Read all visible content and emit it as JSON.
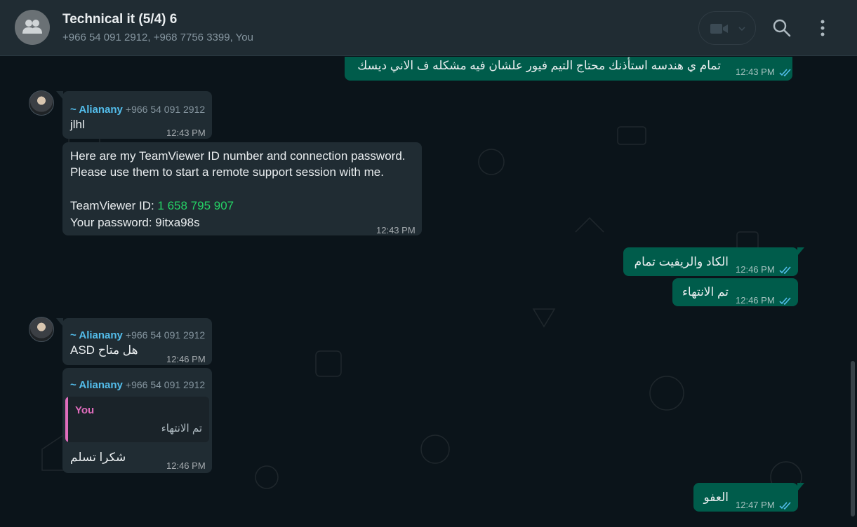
{
  "header": {
    "title": "Technical it (5/4) 6",
    "participants": "+966 54 091 2912, +968 7756 3399, You",
    "avatar_icon": "group-icon",
    "video_icon": "video-camera-icon",
    "search_icon": "search-icon",
    "menu_icon": "more-vertical-icon"
  },
  "messages": [
    {
      "id": "m1",
      "direction": "out",
      "text": "تمام ي هندسه استأذنك محتاج التيم فيور علشان فيه مشكله ف الاني ديسك",
      "time": "12:43 PM",
      "status": "read"
    },
    {
      "id": "m2",
      "direction": "in",
      "sender": "~ Alianany",
      "phone": "+966 54 091 2912",
      "text": "jlhl",
      "time": "12:43 PM"
    },
    {
      "id": "m3",
      "direction": "in",
      "line1": "Here are my TeamViewer ID number and connection password.",
      "line2": "Please use them to start a remote support session with me.",
      "id_label": "TeamViewer ID: ",
      "id_value": "1 658 795 907",
      "password_line": "Your password: 9itxa98s",
      "time": "12:43 PM"
    },
    {
      "id": "m4",
      "direction": "out",
      "text": "الكاد والريفيت تمام",
      "time": "12:46 PM",
      "status": "read"
    },
    {
      "id": "m5",
      "direction": "out",
      "text": "تم الانتهاء",
      "time": "12:46 PM",
      "status": "read"
    },
    {
      "id": "m6",
      "direction": "in",
      "sender": "~ Alianany",
      "phone": "+966 54 091 2912",
      "text": "هل متاح ASD",
      "time": "12:46 PM"
    },
    {
      "id": "m7",
      "direction": "in",
      "sender": "~ Alianany",
      "phone": "+966 54 091 2912",
      "quote_author": "You",
      "quote_text": "تم الانتهاء",
      "text": "شكرا تسلم",
      "time": "12:46 PM"
    },
    {
      "id": "m8",
      "direction": "out",
      "text": "العفو",
      "time": "12:47 PM",
      "status": "read"
    }
  ],
  "colors": {
    "bg": "#0b141a",
    "header": "#202c33",
    "outgoing": "#005c4b",
    "incoming": "#202c33",
    "sender_name": "#53bdeb",
    "ticks": "#53bdeb",
    "link_green": "#25d366",
    "quote_bar": "#e06dbd"
  }
}
